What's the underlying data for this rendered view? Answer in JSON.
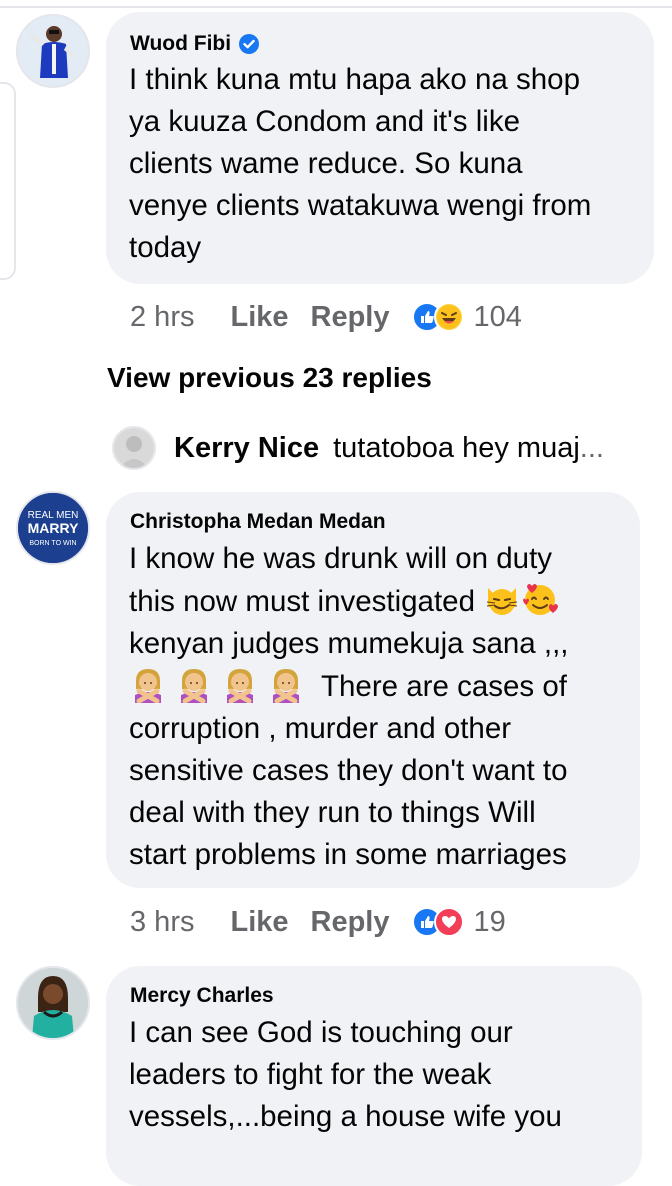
{
  "comments": [
    {
      "author": "Wuod Fibi",
      "verified": true,
      "lines": [
        "I think kuna mtu hapa ako na shop",
        "ya kuuza Condom and it's like",
        "clients wame reduce. So kuna",
        "venye clients watakuwa wengi from",
        "today"
      ],
      "time": "2 hrs",
      "like_label": "Like",
      "reply_label": "Reply",
      "reaction_icons": [
        "like-icon",
        "laughing-emoji-icon"
      ],
      "reaction_count": "104"
    },
    {
      "author": "Christopha Medan Medan",
      "avatar_text": [
        "REAL MEN",
        "MARRY",
        "BORN TO WIN"
      ],
      "lines": [
        "I know he was drunk will on duty",
        "this now must investigated",
        "kenyan judges mumekuja sana ,,,",
        "There are cases of",
        "corruption , murder and other",
        "sensitive cases they don't want to",
        "deal with they run to things Will",
        "start problems in some marriages"
      ],
      "line2_emojis": [
        "smirking-cat-emoji",
        "smiling-hearts-emoji"
      ],
      "line4_emojis": [
        "person-gesturing-no-emoji",
        "person-gesturing-no-emoji",
        "person-gesturing-no-emoji",
        "person-gesturing-no-emoji"
      ],
      "time": "3 hrs",
      "like_label": "Like",
      "reply_label": "Reply",
      "reaction_icons": [
        "like-icon",
        "love-icon"
      ],
      "reaction_count": "19"
    },
    {
      "author": "Mercy Charles",
      "lines": [
        "I can see God is touching our",
        "leaders to fight for the weak",
        "vessels,...being a house wife you"
      ]
    }
  ],
  "view_previous": "View previous 23 replies",
  "reply_preview": {
    "author": "Kerry Nice",
    "text": "tutatoboa hey muaj",
    "ellipsis": "..."
  },
  "colors": {
    "bubble": "#f0f2f5",
    "meta_text": "#65676b",
    "like_blue": "#1877f2",
    "love_red": "#f33e58"
  }
}
